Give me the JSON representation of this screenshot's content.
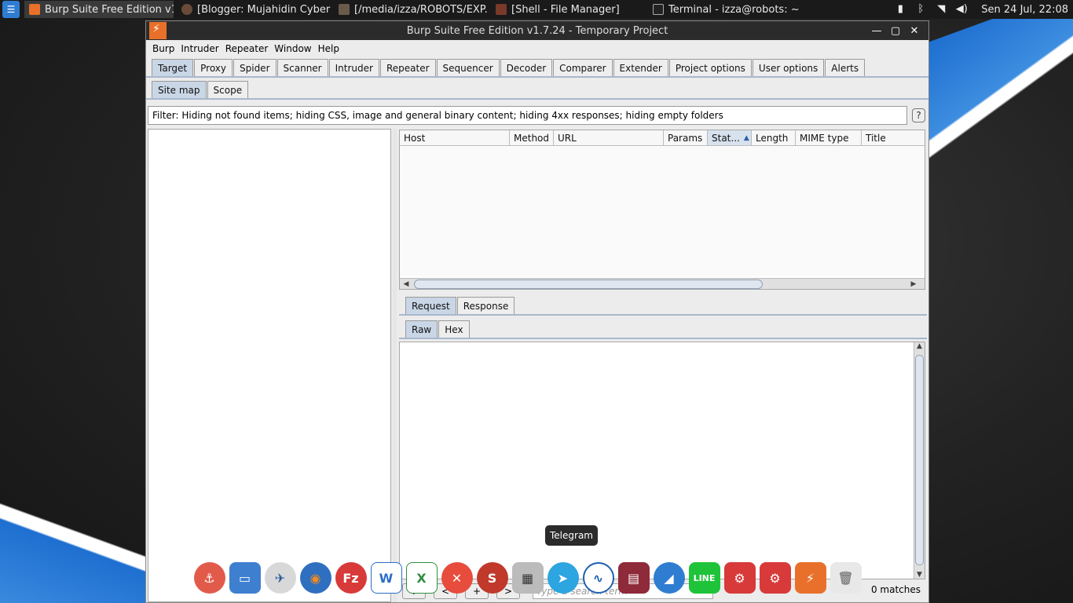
{
  "taskbar": {
    "tasks": [
      {
        "label": "Burp Suite Free Edition v1....",
        "active": true
      },
      {
        "label": "[Blogger: Mujahidin Cyber ..."
      },
      {
        "label": "[/media/izza/ROBOTS/EXP..."
      },
      {
        "label": "[Shell - File Manager]"
      },
      {
        "label": "Terminal - izza@robots: ~"
      }
    ],
    "clock": "Sen 24 Jul, 22:08"
  },
  "window": {
    "title": "Burp Suite Free Edition v1.7.24 - Temporary Project",
    "menu": [
      "Burp",
      "Intruder",
      "Repeater",
      "Window",
      "Help"
    ],
    "tabs": [
      "Target",
      "Proxy",
      "Spider",
      "Scanner",
      "Intruder",
      "Repeater",
      "Sequencer",
      "Decoder",
      "Comparer",
      "Extender",
      "Project options",
      "User options",
      "Alerts"
    ],
    "selected_tab": "Target",
    "subtabs": [
      "Site map",
      "Scope"
    ],
    "filter_text": "Filter: Hiding not found items;  hiding CSS, image and general binary content;  hiding 4xx responses;  hiding empty folders",
    "help_label": "?",
    "columns": [
      "Host",
      "Method",
      "URL",
      "Params",
      "Stat...",
      "Length",
      "MIME type",
      "Title"
    ],
    "lower_tabs": [
      "Request",
      "Response"
    ],
    "lower_subtabs": [
      "Raw",
      "Hex"
    ],
    "nav_buttons": [
      "?",
      "<",
      "+",
      ">"
    ],
    "search_placeholder": "Type a search term",
    "matches": "0 matches"
  },
  "dock": {
    "tooltip": "Telegram",
    "icons": [
      "anchor-icon",
      "files-icon",
      "bird-icon",
      "firefox-icon",
      "filezilla-icon",
      "writer-icon",
      "spreadsheet-icon",
      "close-app-icon",
      "app-s-icon",
      "screenshot-icon",
      "telegram-icon",
      "monitor-icon",
      "video-editor-icon",
      "app-blue-icon",
      "line-icon",
      "settings-icon",
      "settings-icon",
      "burp-icon",
      "trash-icon"
    ]
  }
}
